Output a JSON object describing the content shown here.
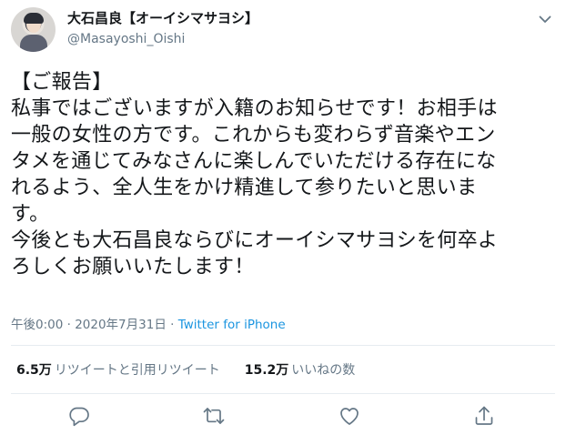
{
  "user": {
    "display_name": "大石昌良【オーイシマサヨシ】",
    "handle": "@Masayoshi_Oishi"
  },
  "tweet": {
    "lines": [
      "【ご報告】",
      "私事ではございますが入籍のお知らせです！お相手は",
      "一般の女性の方です。これからも変わらず音楽やエン",
      "タメを通じてみなさんに楽しんでいただける存在にな",
      "れるよう、全人生をかけ精進して参りたいと思いま",
      "す。",
      "今後とも大石昌良ならびにオーイシマサヨシを何卒よ",
      "ろしくお願いいたします！"
    ]
  },
  "meta": {
    "time": "午後0:00 · 2020年7月31日 · ",
    "source": "Twitter for iPhone"
  },
  "stats": {
    "retweets_count": "6.5万",
    "retweets_label": "リツイートと引用リツイート",
    "likes_count": "15.2万",
    "likes_label": "いいねの数"
  },
  "colors": {
    "text": "#14171a",
    "secondary": "#657786",
    "link": "#1b95e0",
    "divider": "#e6ecf0"
  },
  "icons": {
    "reply": "reply-icon",
    "retweet": "retweet-icon",
    "like": "like-icon",
    "share": "share-icon",
    "more": "chevron-down-icon"
  }
}
